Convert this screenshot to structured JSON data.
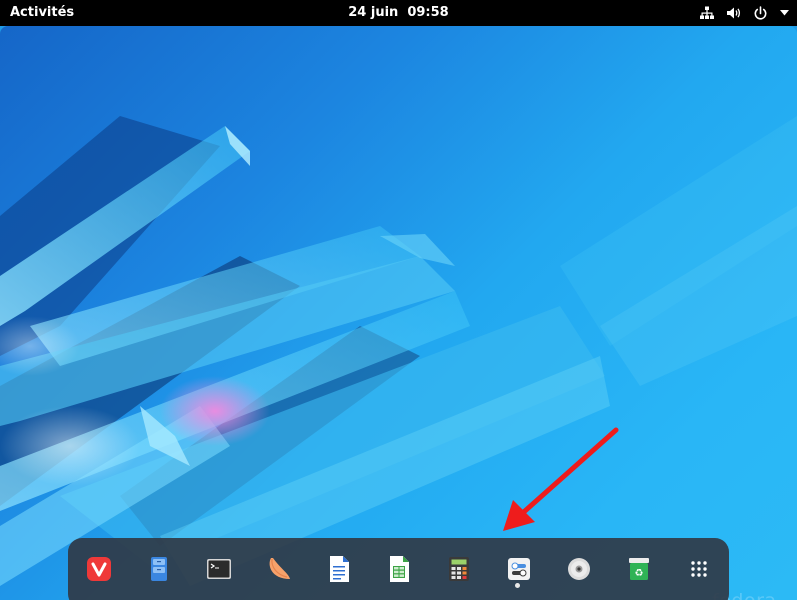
{
  "topbar": {
    "activities_label": "Activités",
    "clock": "24 juin  09:58",
    "tray": [
      "network-wired-icon",
      "volume-icon",
      "power-icon",
      "menu-arrow-icon"
    ]
  },
  "dash": {
    "apps": [
      {
        "name": "vivaldi-browser-icon",
        "color": "#ef3939"
      },
      {
        "name": "file-manager-icon",
        "color": "#3a86e0"
      },
      {
        "name": "terminal-icon",
        "color": "#2b2b2b"
      },
      {
        "name": "mango-app-icon",
        "color": "#f6a26b"
      },
      {
        "name": "text-document-icon",
        "color": "#2f6fd1"
      },
      {
        "name": "spreadsheet-icon",
        "color": "#3ca345"
      },
      {
        "name": "calculator-icon",
        "color": "#3a3a3a"
      },
      {
        "name": "settings-tweaks-icon",
        "color": "#f2f2f2"
      },
      {
        "name": "disc-icon",
        "color": "#dcdcdc"
      },
      {
        "name": "software-recycle-icon",
        "color": "#2fb356"
      },
      {
        "name": "show-applications-icon",
        "color": "#ffffff"
      }
    ],
    "running_app_index": 7
  },
  "wallpaper": {
    "watermark": "fedora",
    "colors": {
      "top": "#1566c8",
      "bottom": "#2cbaf5",
      "accent": "#e87ad9"
    }
  },
  "annotation": {
    "arrow_color": "#ee1c1c"
  }
}
